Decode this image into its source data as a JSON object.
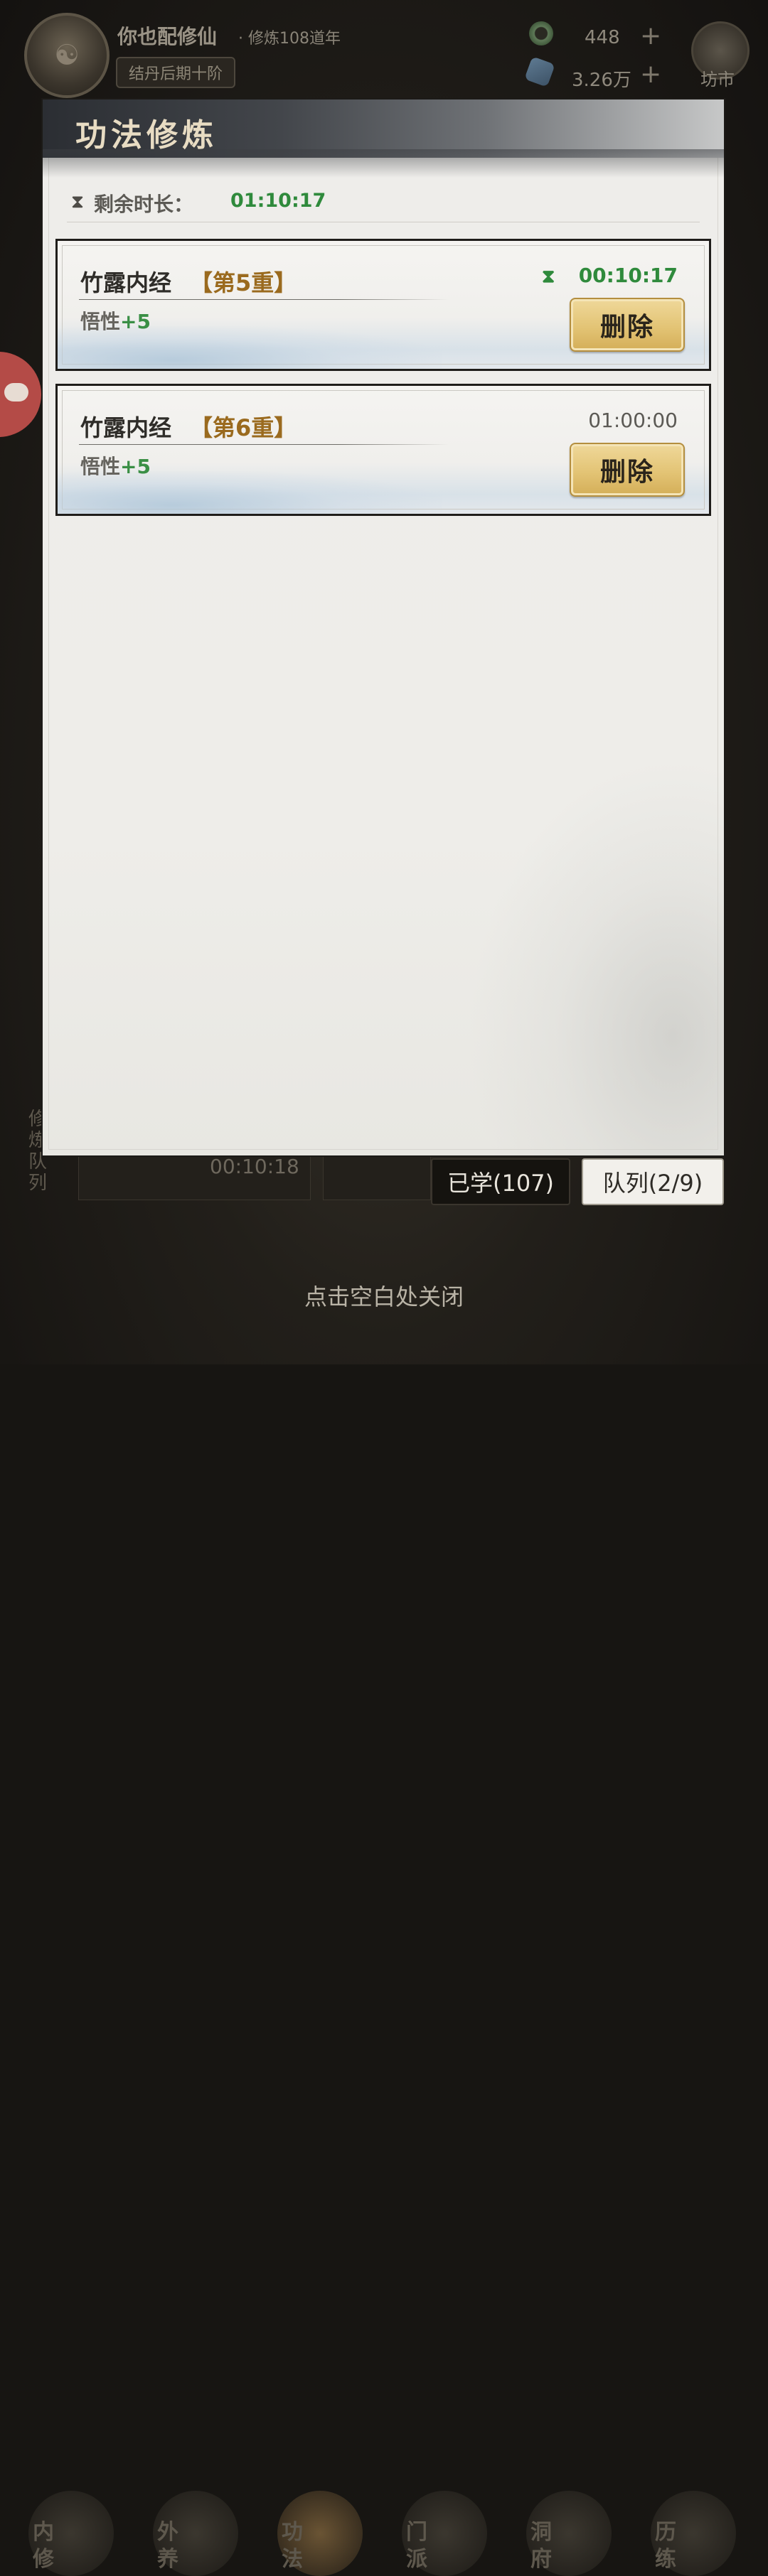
{
  "player": {
    "name": "你也配修仙",
    "subtitle": "· 修炼108道年",
    "realm": "结丹后期十阶"
  },
  "resources": [
    {
      "icon": "jade-ring-icon",
      "value": "448",
      "plus": "+"
    },
    {
      "icon": "spirit-stone-icon",
      "value": "3.26万",
      "plus": "+"
    }
  ],
  "market": {
    "label": "坊市"
  },
  "panel": {
    "title": "功法修炼",
    "remaining_label": "剩余时长：",
    "remaining_value": "01:10:17",
    "items": [
      {
        "name": "竹露内经",
        "level": "【第5重】",
        "stat_label": "悟性",
        "stat_bonus": "+5",
        "time": "00:10:17",
        "active": true,
        "delete_label": "删除"
      },
      {
        "name": "竹露内经",
        "level": "【第6重】",
        "stat_label": "悟性",
        "stat_bonus": "+5",
        "time": "01:00:00",
        "active": false,
        "delete_label": "删除"
      }
    ]
  },
  "tabs": {
    "learned": "已学(107)",
    "queue": "队列(2/9)"
  },
  "background": {
    "queue_side_label": "修炼队列",
    "queue_time": "00:10:18",
    "nav": [
      "内修",
      "外养",
      "功法",
      "门派",
      "洞府",
      "历练"
    ]
  },
  "close_hint": "点击空白处关闭",
  "colors": {
    "accent_green": "#2f8a3c",
    "level_gold": "#9a6a1e",
    "button_gold": "#e3c475"
  }
}
